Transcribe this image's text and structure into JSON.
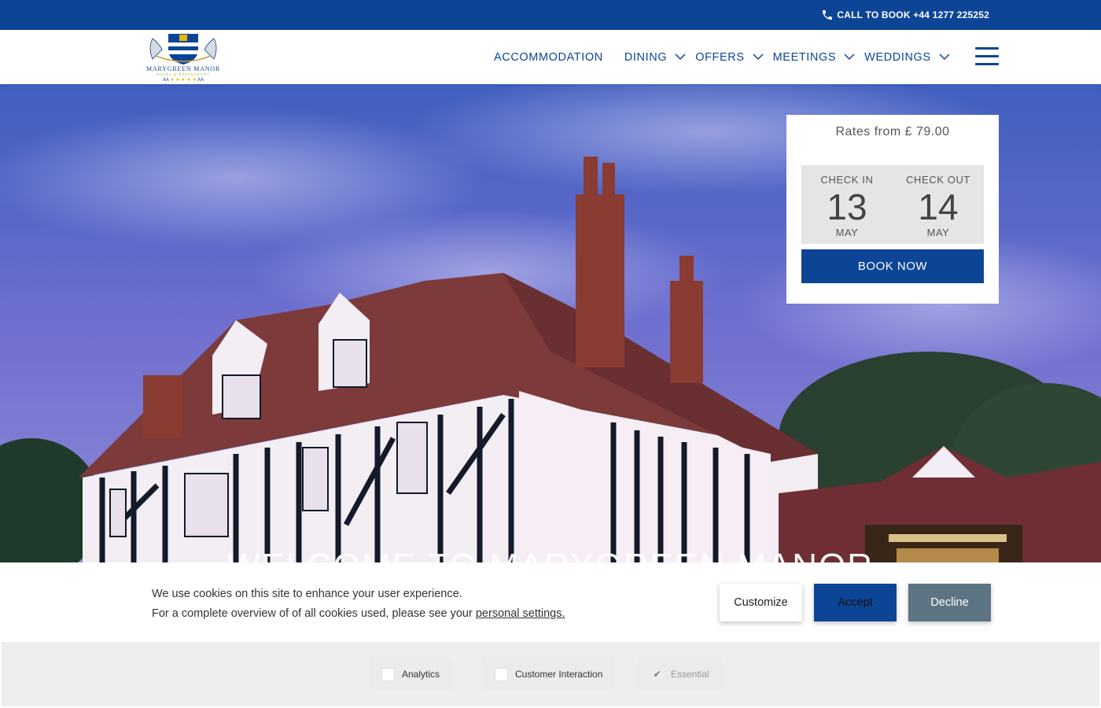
{
  "topbar": {
    "call_text": "CALL TO BOOK +44 1277 225252",
    "bg_color": "#0d4596"
  },
  "logo": {
    "name": "MARYGREEN MANOR",
    "subtitle": "HOTEL & RESTAURANT",
    "rating_left": "AA",
    "rating_stars": "★ ★ ★ ★ ★",
    "rating_right": "AA"
  },
  "nav": {
    "items": [
      {
        "label": "ACCOMMODATION",
        "has_dropdown": false
      },
      {
        "label": "DINING",
        "has_dropdown": true
      },
      {
        "label": "OFFERS",
        "has_dropdown": true
      },
      {
        "label": "MEETINGS",
        "has_dropdown": true
      },
      {
        "label": "WEDDINGS",
        "has_dropdown": true
      }
    ],
    "menu_icon": "hamburger-icon"
  },
  "hero": {
    "heading": "WELCOME TO MARYGREEN MANOR"
  },
  "booking": {
    "rates_text": "Rates from £ 79.00",
    "check_in": {
      "label": "CHECK IN",
      "day": "13",
      "month": "MAY"
    },
    "check_out": {
      "label": "CHECK OUT",
      "day": "14",
      "month": "MAY"
    },
    "book_label": "BOOK NOW"
  },
  "cookie": {
    "line1": "We use cookies on this site to enhance your user experience.",
    "line2_prefix": "For a complete overview of of all cookies used, please see your ",
    "line2_link": "personal settings.",
    "customize_label": "Customize",
    "accept_label": "Accept",
    "decline_label": "Decline",
    "prefs": [
      {
        "label": "Analytics",
        "checked": false,
        "disabled": false
      },
      {
        "label": "Customer Interaction",
        "checked": false,
        "disabled": false
      },
      {
        "label": "Essential",
        "checked": true,
        "disabled": true
      }
    ]
  },
  "colors": {
    "brand_blue": "#0d4596",
    "decline_gray": "#5c7484",
    "dates_bg": "#e5e5e5"
  }
}
